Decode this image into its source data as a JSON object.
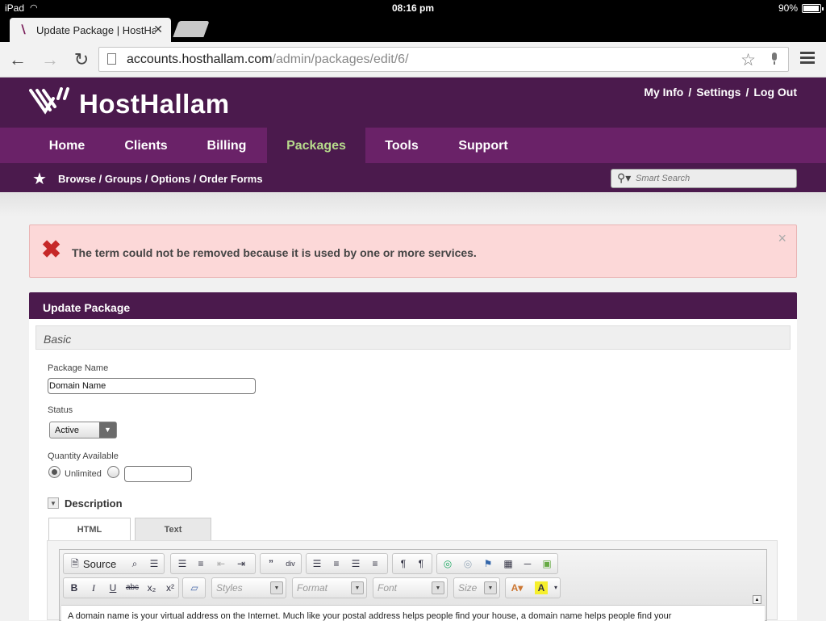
{
  "statusbar": {
    "device": "iPad",
    "time": "08:16 pm",
    "battery": "90%"
  },
  "browser": {
    "tab_title": "Update Package | HostHallam",
    "url_host": "accounts.hosthallam.com",
    "url_path": "/admin/packages/edit/6/"
  },
  "site": {
    "brand": "HostHallam",
    "userlinks": {
      "info": "My Info",
      "settings": "Settings",
      "logout": "Log Out",
      "separator": "/"
    },
    "nav": [
      {
        "label": "Home",
        "active": false
      },
      {
        "label": "Clients",
        "active": false
      },
      {
        "label": "Billing",
        "active": false
      },
      {
        "label": "Packages",
        "active": true
      },
      {
        "label": "Tools",
        "active": false
      },
      {
        "label": "Support",
        "active": false
      }
    ],
    "subnav": [
      "Browse",
      "Groups",
      "Options",
      "Order Forms"
    ],
    "search_placeholder": "Smart Search",
    "colors": {
      "header": "#4b1a4d",
      "nav": "#6a2268",
      "active_nav_text": "#b7db8c"
    }
  },
  "alert": {
    "message": "The term could not be removed because it is used by one or more services.",
    "close": "×"
  },
  "form": {
    "panel_title": "Update Package",
    "section": "Basic",
    "package_name_label": "Package Name",
    "package_name_value": "Domain Name",
    "status_label": "Status",
    "status_value": "Active",
    "quantity_label": "Quantity Available",
    "unlimited_label": "Unlimited",
    "description_label": "Description",
    "tabs": [
      "HTML",
      "Text"
    ]
  },
  "editor": {
    "source_label": "Source",
    "combos": [
      "Styles",
      "Format",
      "Font",
      "Size"
    ],
    "body_text": "A domain name is your virtual address on the Internet. Much like your postal address helps people find your house, a domain name helps people find your"
  }
}
